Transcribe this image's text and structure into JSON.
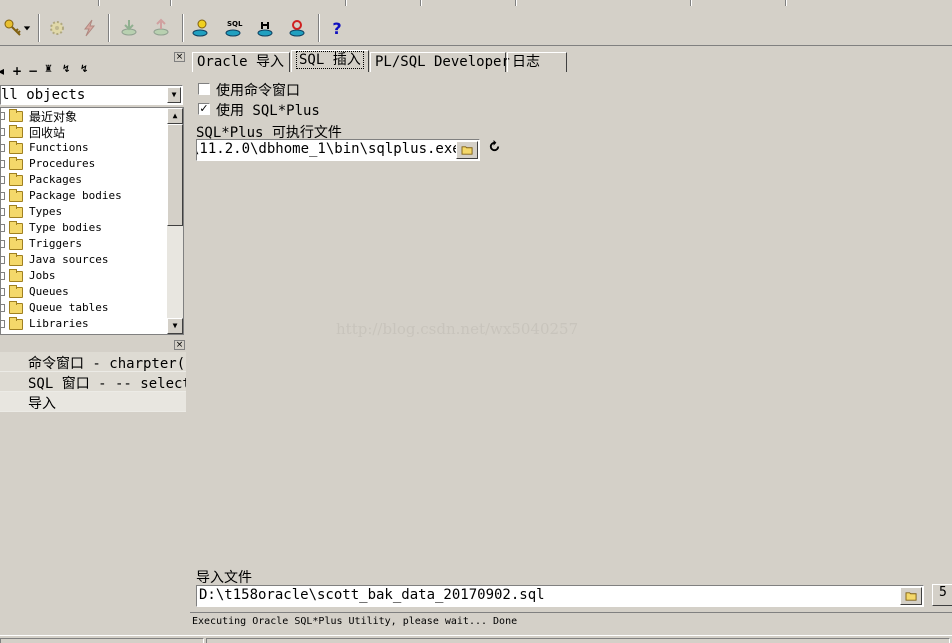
{
  "toolbar": {
    "icons": [
      "key-icon",
      "dropdown-arrow-icon",
      "gear-icon",
      "lightning-icon",
      "import-tables-icon",
      "export-tables-icon",
      "user-icon",
      "sql-db-icon",
      "db-connect-icon",
      "db-refresh-icon",
      "help-icon"
    ],
    "help_label": "?"
  },
  "object_browser": {
    "filter_value": "ll objects",
    "items": [
      {
        "label": "最近对象"
      },
      {
        "label": "回收站"
      },
      {
        "label": "Functions"
      },
      {
        "label": "Procedures"
      },
      {
        "label": "Packages"
      },
      {
        "label": "Package bodies"
      },
      {
        "label": "Types"
      },
      {
        "label": "Type bodies"
      },
      {
        "label": "Triggers"
      },
      {
        "label": "Java sources"
      },
      {
        "label": "Jobs"
      },
      {
        "label": "Queues"
      },
      {
        "label": "Queue tables"
      },
      {
        "label": "Libraries"
      }
    ]
  },
  "window_list": {
    "items": [
      {
        "label": "命令窗口 - charpter("
      },
      {
        "label": "SQL 窗口 - -- select"
      },
      {
        "label": "导入"
      }
    ]
  },
  "tabs": [
    {
      "label": "Oracle 导入",
      "active": false
    },
    {
      "label": "SQL 插入",
      "active": true
    },
    {
      "label": "PL/SQL Developer",
      "active": false
    },
    {
      "label": "日志",
      "active": false
    }
  ],
  "options": {
    "use_command_window": {
      "label": "使用命令窗口",
      "checked": false
    },
    "use_sqlplus": {
      "label": "使用 SQL*Plus",
      "checked": true,
      "mark": "✓"
    }
  },
  "sqlplus_exe": {
    "label": "SQL*Plus 可执行文件",
    "value": "\\11.2.0\\dbhome_1\\bin\\sqlplus.exe"
  },
  "watermark": "http://blog.csdn.net/wx5040257",
  "import_file": {
    "label": "导入文件",
    "value": "D:\\t158oracle\\scott_bak_data_20170902.sql"
  },
  "status": "Executing Oracle SQL*Plus Utility, please wait... Done",
  "side_button": "5"
}
